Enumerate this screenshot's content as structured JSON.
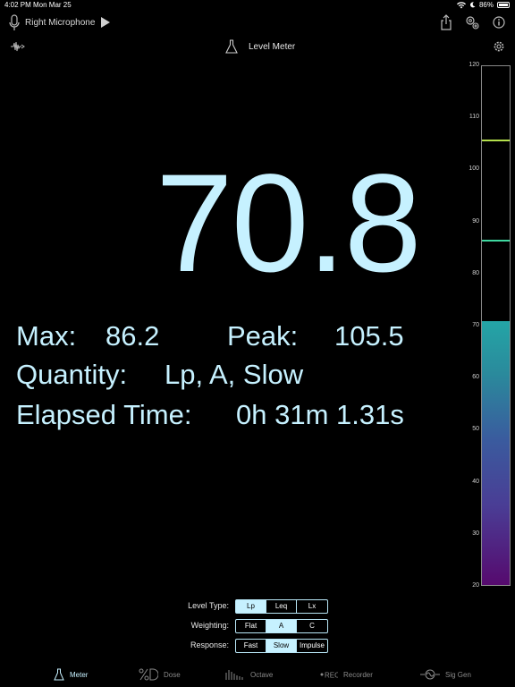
{
  "status_bar": {
    "time": "4:02 PM",
    "date": "Mon Mar 25",
    "battery": "86%"
  },
  "toolbar": {
    "source": "Right Microphone"
  },
  "navbar": {
    "title": "Level Meter"
  },
  "readout": {
    "value": "70.8",
    "max_label": "Max:",
    "max_value": "86.2",
    "peak_label": "Peak:",
    "peak_value": "105.5",
    "quantity_label": "Quantity:",
    "quantity_value": "Lp, A, Slow",
    "elapsed_label": "Elapsed Time:",
    "elapsed_value": "0h 31m 1.31s"
  },
  "meter": {
    "min": 20,
    "max": 120,
    "ticks": [
      "120",
      "110",
      "100",
      "90",
      "80",
      "70",
      "60",
      "50",
      "40",
      "30",
      "20"
    ],
    "level": 70.8,
    "peak_marker": 105.5,
    "max_marker": 86.2,
    "colors": {
      "peak": "#b4e04c",
      "max": "#3fd8a0"
    }
  },
  "controls": {
    "level_type": {
      "label": "Level Type:",
      "options": [
        "Lp",
        "Leq",
        "Lx"
      ],
      "selected": "Lp"
    },
    "weighting": {
      "label": "Weighting:",
      "options": [
        "Flat",
        "A",
        "C"
      ],
      "selected": "A"
    },
    "response": {
      "label": "Response:",
      "options": [
        "Fast",
        "Slow",
        "Impulse"
      ],
      "selected": "Slow"
    }
  },
  "tabs": [
    {
      "label": "Meter",
      "icon": "flask-icon",
      "active": true
    },
    {
      "label": "Dose",
      "icon": "percent-dose-icon",
      "active": false
    },
    {
      "label": "Octave",
      "icon": "octave-bars-icon",
      "active": false
    },
    {
      "label": "Recorder",
      "icon": "rec-icon",
      "active": false
    },
    {
      "label": "Sig Gen",
      "icon": "sine-wave-icon",
      "active": false
    }
  ],
  "accent_color": "#c6f1ff"
}
